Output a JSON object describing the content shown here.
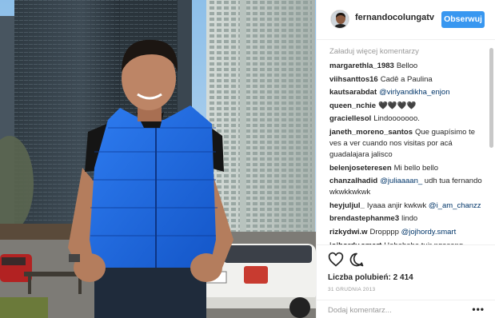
{
  "post": {
    "username": "fernandocolungatv",
    "follow_label": "Obserwuj",
    "load_more": "Załaduj więcej komentarzy",
    "comments": [
      {
        "user": "margarethla_1983",
        "segments": [
          {
            "text": "Belloo",
            "mention": false
          }
        ]
      },
      {
        "user": "viihsanttos16",
        "segments": [
          {
            "text": "Cadê a Paulina",
            "mention": false
          }
        ]
      },
      {
        "user": "kautsarabdat",
        "segments": [
          {
            "text": "@virlyandikha_enjon",
            "mention": true
          }
        ]
      },
      {
        "user": "queen_nchie",
        "segments": [
          {
            "text": "🖤🖤🖤🖤",
            "mention": false
          }
        ]
      },
      {
        "user": "graciellesol",
        "segments": [
          {
            "text": "Lindooooooo.",
            "mention": false
          }
        ]
      },
      {
        "user": "janeth_moreno_santos",
        "segments": [
          {
            "text": "Que guapísimo te ves a ver cuando nos visitas por acá guadalajara jalisco",
            "mention": false
          }
        ]
      },
      {
        "user": "belenjoseteresen",
        "segments": [
          {
            "text": "Mi bello bello",
            "mention": false
          }
        ]
      },
      {
        "user": "chanzalhadid",
        "segments": [
          {
            "text": "@juliaaaan_",
            "mention": true
          },
          {
            "text": " udh tua fernando wkwkkwkwk",
            "mention": false
          }
        ]
      },
      {
        "user": "heyjuljul_",
        "segments": [
          {
            "text": "Iyaaa anjir kwkwk ",
            "mention": false
          },
          {
            "text": "@i_am_chanzz",
            "mention": true
          }
        ]
      },
      {
        "user": "brendastephanme3",
        "segments": [
          {
            "text": "lindo",
            "mention": false
          }
        ]
      },
      {
        "user": "rizkydwi.w",
        "segments": [
          {
            "text": "Dropppp ",
            "mention": false
          },
          {
            "text": "@jojhordy.smart",
            "mention": true
          }
        ]
      },
      {
        "user": "jojhordy.smart",
        "segments": [
          {
            "text": "Hahahaha tuir ngaseng",
            "mention": false
          }
        ]
      }
    ],
    "likes_text": "Liczba polubień: 2 414",
    "date": "31 GRUDNIA 2013",
    "add_comment_placeholder": "Dodaj komentarz...",
    "more_label": "•••",
    "icons": {
      "like": "heart-icon",
      "comment": "comment-icon",
      "more": "more-options-icon"
    }
  }
}
